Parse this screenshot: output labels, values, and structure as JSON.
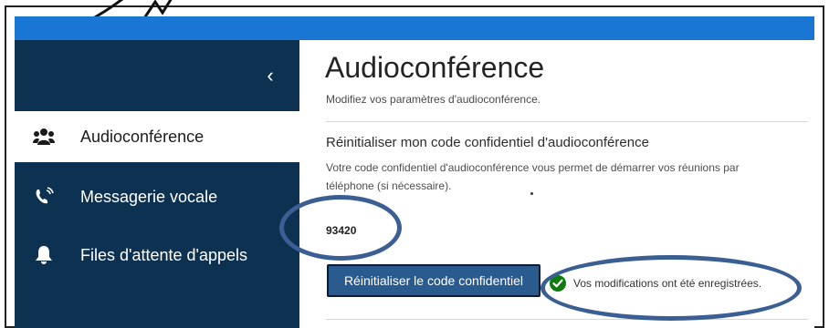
{
  "sidebar": {
    "collapse_glyph": "‹",
    "items": [
      {
        "label": "Audioconférence",
        "icon": "users-icon",
        "active": true
      },
      {
        "label": "Messagerie vocale",
        "icon": "phone-ringing-icon",
        "active": false
      },
      {
        "label": "Files d'attente d'appels",
        "icon": "bell-icon",
        "active": false
      }
    ]
  },
  "main": {
    "title": "Audioconférence",
    "subtitle": "Modifiez vos paramètres d'audioconférence.",
    "section": {
      "title": "Réinitialiser mon code confidentiel d'audioconférence",
      "description": "Votre code confidentiel d'audioconférence vous permet de démarrer vos réunions par téléphone (si nécessaire).",
      "pin": "93420",
      "reset_button": "Réinitialiser le code confidentiel",
      "status_message": "Vos modifications ont été enregistrées."
    }
  },
  "colors": {
    "topbar": "#1976d2",
    "sidebar": "#0d3251",
    "button": "#2a5b8f",
    "success": "#107c10",
    "annotation": "#3b5f93"
  }
}
